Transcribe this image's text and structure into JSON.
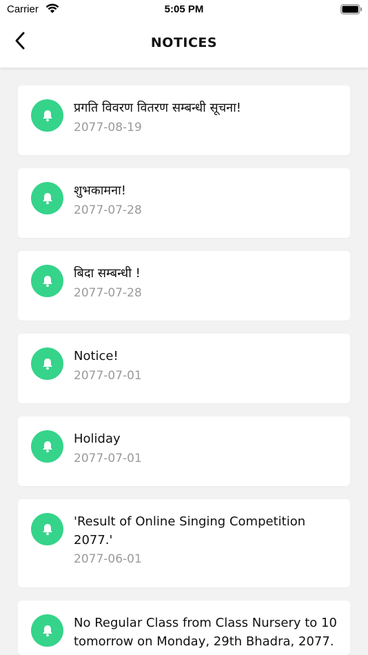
{
  "status_bar": {
    "carrier": "Carrier",
    "time": "5:05 PM"
  },
  "nav": {
    "title": "NOTICES",
    "back_icon": "chevron-left-icon"
  },
  "colors": {
    "accent": "#35d48a",
    "date_text": "#9a9a9a",
    "background": "#f2f2f2"
  },
  "notices": [
    {
      "title": "प्रगति विवरण वितरण सम्बन्धी सूचना!",
      "date": "2077-08-19"
    },
    {
      "title": "शुभकामना!",
      "date": "2077-07-28"
    },
    {
      "title": "बिदा सम्बन्धी !",
      "date": "2077-07-28"
    },
    {
      "title": "Notice!",
      "date": "2077-07-01"
    },
    {
      "title": "Holiday",
      "date": "2077-07-01"
    },
    {
      "title": "'Result of Online Singing Competition 2077.'",
      "date": "2077-06-01"
    },
    {
      "title": "No Regular Class from Class Nursery to 10 tomorrow on Monday, 29th Bhadra, 2077.",
      "date": ""
    }
  ]
}
